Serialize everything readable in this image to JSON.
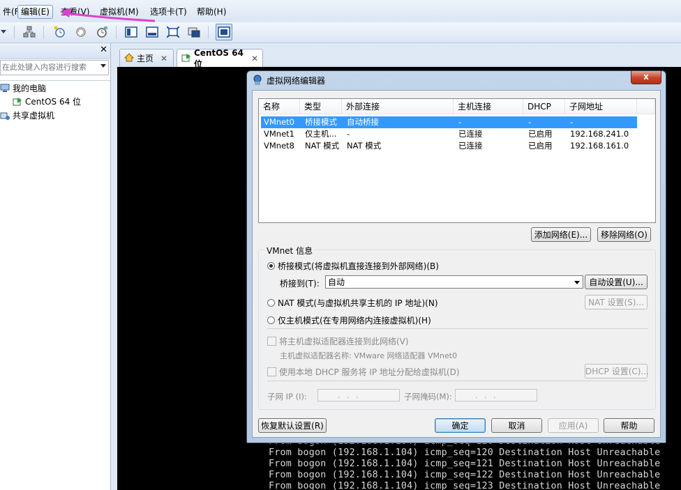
{
  "menubar": {
    "items": [
      "件(F)",
      "编辑(E)",
      "查看(V)",
      "虚拟机(M)",
      "选项卡(T)",
      "帮助(H)"
    ],
    "active_index": 1
  },
  "toolbar": {
    "icons": [
      "dropdown-arrow-icon",
      "network-icon",
      "snapshot-take-icon",
      "snapshot-revert-icon",
      "snapshot-manager-icon",
      "console-view-icon",
      "quick-switch-icon",
      "fullscreen-icon",
      "unity-icon",
      "thumbnail-view-icon"
    ]
  },
  "library": {
    "search_placeholder": "在此处键入内容进行搜索",
    "items": [
      {
        "label": "我的电脑",
        "icon": "computer-icon"
      },
      {
        "label": "CentOS 64 位",
        "icon": "vm-running-icon"
      },
      {
        "label": "共享虚拟机",
        "icon": "shared-vm-icon"
      }
    ]
  },
  "tabs": [
    {
      "label": "主页",
      "icon": "home-icon",
      "active": false
    },
    {
      "label": "CentOS 64 位",
      "icon": "vm-running-icon",
      "active": true
    }
  ],
  "console": {
    "lines": [
      "From bogon (192.168.1.104) icmp_seq=120 Destination Host Unreachable",
      "From bogon (192.168.1.104) icmp_seq=121 Destination Host Unreachable",
      "From bogon (192.168.1.104) icmp_seq=122 Destination Host Unreachable",
      "From bogon (192.168.1.104) icmp_seq=123 Destination Host Unreachable"
    ]
  },
  "dialog": {
    "title": "虚拟网络编辑器",
    "close_label": "x",
    "table": {
      "columns": [
        "名称",
        "类型",
        "外部连接",
        "主机连接",
        "DHCP",
        "子网地址"
      ],
      "rows": [
        [
          "VMnet0",
          "桥接模式",
          "自动桥接",
          "-",
          "-",
          "-"
        ],
        [
          "VMnet1",
          "仅主机...",
          "-",
          "已连接",
          "已启用",
          "192.168.241.0"
        ],
        [
          "VMnet8",
          "NAT 模式",
          "NAT 模式",
          "已连接",
          "已启用",
          "192.168.161.0"
        ]
      ],
      "selected_row": 0
    },
    "add_network_label": "添加网络(E)...",
    "remove_network_label": "移除网络(O)",
    "group_label": "VMnet 信息",
    "radio_bridged": "桥接模式(将虚拟机直接连接到外部网络)(B)",
    "bridge_to_label": "桥接到(T):",
    "bridge_to_value": "自动",
    "auto_settings_label": "自动设置(U)...",
    "radio_nat": "NAT 模式(与虚拟机共享主机的 IP 地址)(N)",
    "nat_settings_label": "NAT 设置(S)...",
    "radio_hostonly": "仅主机模式(在专用网络内连接虚拟机)(H)",
    "selected_mode": "bridged",
    "check_connect_adapter": "将主机虚拟适配器连接到此网络(V)",
    "adapter_name_label": "主机虚拟适配器名称: VMware 网络适配器 VMnet0",
    "check_dhcp": "使用本地 DHCP 服务将 IP 地址分配给虚拟机(D)",
    "dhcp_settings_label": "DHCP 设置(C)...",
    "subnet_ip_label": "子网 IP (I):",
    "subnet_mask_label": "子网掩码(M):",
    "ip_placeholder": ".   .   .",
    "restore_defaults_label": "恢复默认设置(R)",
    "ok_label": "确定",
    "cancel_label": "取消",
    "apply_label": "应用(A)",
    "help_label": "帮助"
  },
  "colors": {
    "annotation_arrow": "#e040d0",
    "selection": "#3399ff",
    "dialog_close": "#c6432b"
  }
}
